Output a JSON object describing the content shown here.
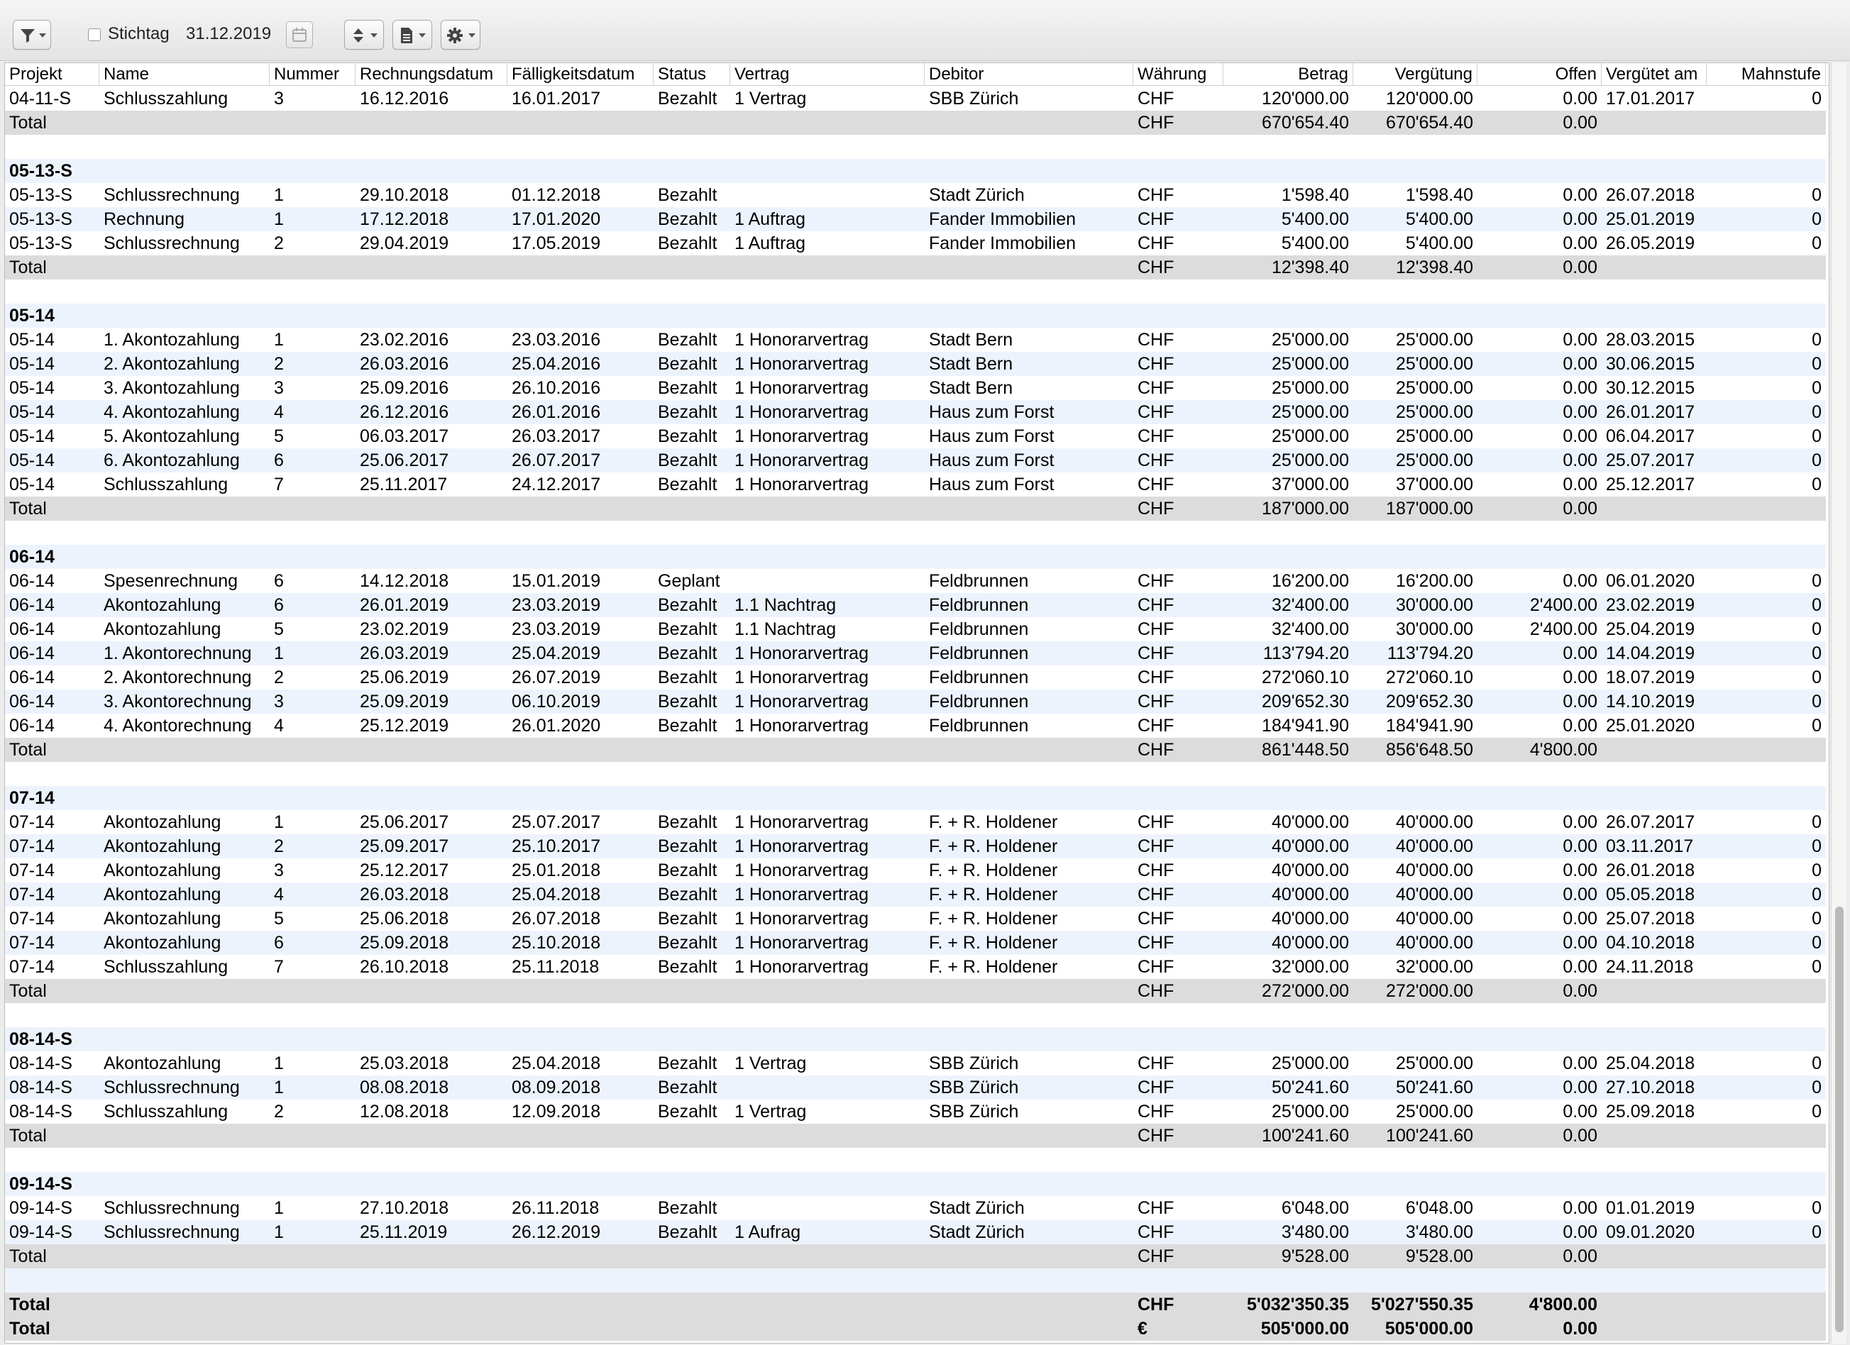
{
  "toolbar": {
    "stichtag_label": "Stichtag",
    "stichtag_checked": false,
    "stichtag_date": "31.12.2019",
    "icons": [
      "filter-icon",
      "sort-icon",
      "document-icon",
      "gear-icon",
      "calendar-icon"
    ]
  },
  "columns": [
    "Projekt",
    "Name",
    "Nummer",
    "Rechnungsdatum",
    "Fälligkeitsdatum",
    "Status",
    "Vertrag",
    "Debitor",
    "Währung",
    "Betrag",
    "Vergütung",
    "Offen",
    "Vergütet am",
    "Mahnstufe"
  ],
  "rows": [
    {
      "type": "data",
      "cells": [
        "04-11-S",
        "Schlusszahlung",
        "3",
        "16.12.2016",
        "16.01.2017",
        "Bezahlt",
        "1 Vertrag",
        "SBB Zürich",
        "CHF",
        "120'000.00",
        "120'000.00",
        "0.00",
        "17.01.2017",
        "0"
      ]
    },
    {
      "type": "total",
      "cells": [
        "Total",
        "",
        "",
        "",
        "",
        "",
        "",
        "",
        "CHF",
        "670'654.40",
        "670'654.40",
        "0.00",
        "",
        ""
      ]
    },
    {
      "type": "blank",
      "cells": [
        "",
        "",
        "",
        "",
        "",
        "",
        "",
        "",
        "",
        "",
        "",
        "",
        "",
        ""
      ]
    },
    {
      "type": "group",
      "cells": [
        "05-13-S",
        "",
        "",
        "",
        "",
        "",
        "",
        "",
        "",
        "",
        "",
        "",
        "",
        ""
      ]
    },
    {
      "type": "data",
      "cells": [
        "05-13-S",
        "Schlussrechnung",
        "1",
        "29.10.2018",
        "01.12.2018",
        "Bezahlt",
        "",
        "Stadt Zürich",
        "CHF",
        "1'598.40",
        "1'598.40",
        "0.00",
        "26.07.2018",
        "0"
      ]
    },
    {
      "type": "data",
      "cells": [
        "05-13-S",
        "Rechnung",
        "1",
        "17.12.2018",
        "17.01.2020",
        "Bezahlt",
        "1 Auftrag",
        "Fander Immobilien",
        "CHF",
        "5'400.00",
        "5'400.00",
        "0.00",
        "25.01.2019",
        "0"
      ]
    },
    {
      "type": "data",
      "cells": [
        "05-13-S",
        "Schlussrechnung",
        "2",
        "29.04.2019",
        "17.05.2019",
        "Bezahlt",
        "1 Auftrag",
        "Fander Immobilien",
        "CHF",
        "5'400.00",
        "5'400.00",
        "0.00",
        "26.05.2019",
        "0"
      ]
    },
    {
      "type": "total",
      "cells": [
        "Total",
        "",
        "",
        "",
        "",
        "",
        "",
        "",
        "CHF",
        "12'398.40",
        "12'398.40",
        "0.00",
        "",
        ""
      ]
    },
    {
      "type": "blank",
      "cells": [
        "",
        "",
        "",
        "",
        "",
        "",
        "",
        "",
        "",
        "",
        "",
        "",
        "",
        ""
      ]
    },
    {
      "type": "group",
      "cells": [
        "05-14",
        "",
        "",
        "",
        "",
        "",
        "",
        "",
        "",
        "",
        "",
        "",
        "",
        ""
      ]
    },
    {
      "type": "data",
      "cells": [
        "05-14",
        "1. Akontozahlung",
        "1",
        "23.02.2016",
        "23.03.2016",
        "Bezahlt",
        "1 Honorarvertrag",
        "Stadt Bern",
        "CHF",
        "25'000.00",
        "25'000.00",
        "0.00",
        "28.03.2015",
        "0"
      ]
    },
    {
      "type": "data",
      "cells": [
        "05-14",
        "2. Akontozahlung",
        "2",
        "26.03.2016",
        "25.04.2016",
        "Bezahlt",
        "1 Honorarvertrag",
        "Stadt Bern",
        "CHF",
        "25'000.00",
        "25'000.00",
        "0.00",
        "30.06.2015",
        "0"
      ]
    },
    {
      "type": "data",
      "cells": [
        "05-14",
        "3. Akontozahlung",
        "3",
        "25.09.2016",
        "26.10.2016",
        "Bezahlt",
        "1 Honorarvertrag",
        "Stadt Bern",
        "CHF",
        "25'000.00",
        "25'000.00",
        "0.00",
        "30.12.2015",
        "0"
      ]
    },
    {
      "type": "data",
      "cells": [
        "05-14",
        "4. Akontozahlung",
        "4",
        "26.12.2016",
        "26.01.2016",
        "Bezahlt",
        "1 Honorarvertrag",
        "Haus zum Forst",
        "CHF",
        "25'000.00",
        "25'000.00",
        "0.00",
        "26.01.2017",
        "0"
      ]
    },
    {
      "type": "data",
      "cells": [
        "05-14",
        "5. Akontozahlung",
        "5",
        "06.03.2017",
        "26.03.2017",
        "Bezahlt",
        "1 Honorarvertrag",
        "Haus zum Forst",
        "CHF",
        "25'000.00",
        "25'000.00",
        "0.00",
        "06.04.2017",
        "0"
      ]
    },
    {
      "type": "data",
      "cells": [
        "05-14",
        "6. Akontozahlung",
        "6",
        "25.06.2017",
        "26.07.2017",
        "Bezahlt",
        "1 Honorarvertrag",
        "Haus zum Forst",
        "CHF",
        "25'000.00",
        "25'000.00",
        "0.00",
        "25.07.2017",
        "0"
      ]
    },
    {
      "type": "data",
      "cells": [
        "05-14",
        "Schlusszahlung",
        "7",
        "25.11.2017",
        "24.12.2017",
        "Bezahlt",
        "1 Honorarvertrag",
        "Haus zum Forst",
        "CHF",
        "37'000.00",
        "37'000.00",
        "0.00",
        "25.12.2017",
        "0"
      ]
    },
    {
      "type": "total",
      "cells": [
        "Total",
        "",
        "",
        "",
        "",
        "",
        "",
        "",
        "CHF",
        "187'000.00",
        "187'000.00",
        "0.00",
        "",
        ""
      ]
    },
    {
      "type": "blank",
      "cells": [
        "",
        "",
        "",
        "",
        "",
        "",
        "",
        "",
        "",
        "",
        "",
        "",
        "",
        ""
      ]
    },
    {
      "type": "group",
      "cells": [
        "06-14",
        "",
        "",
        "",
        "",
        "",
        "",
        "",
        "",
        "",
        "",
        "",
        "",
        ""
      ]
    },
    {
      "type": "data",
      "cells": [
        "06-14",
        "Spesenrechnung",
        "6",
        "14.12.2018",
        "15.01.2019",
        "Geplant",
        "",
        "Feldbrunnen",
        "CHF",
        "16'200.00",
        "16'200.00",
        "0.00",
        "06.01.2020",
        "0"
      ]
    },
    {
      "type": "data",
      "cells": [
        "06-14",
        "Akontozahlung",
        "6",
        "26.01.2019",
        "23.03.2019",
        "Bezahlt",
        "1.1 Nachtrag",
        "Feldbrunnen",
        "CHF",
        "32'400.00",
        "30'000.00",
        "2'400.00",
        "23.02.2019",
        "0"
      ]
    },
    {
      "type": "data",
      "cells": [
        "06-14",
        "Akontozahlung",
        "5",
        "23.02.2019",
        "23.03.2019",
        "Bezahlt",
        "1.1 Nachtrag",
        "Feldbrunnen",
        "CHF",
        "32'400.00",
        "30'000.00",
        "2'400.00",
        "25.04.2019",
        "0"
      ]
    },
    {
      "type": "data",
      "cells": [
        "06-14",
        "1. Akontorechnung",
        "1",
        "26.03.2019",
        "25.04.2019",
        "Bezahlt",
        "1 Honorarvertrag",
        "Feldbrunnen",
        "CHF",
        "113'794.20",
        "113'794.20",
        "0.00",
        "14.04.2019",
        "0"
      ]
    },
    {
      "type": "data",
      "cells": [
        "06-14",
        "2. Akontorechnung",
        "2",
        "25.06.2019",
        "26.07.2019",
        "Bezahlt",
        "1 Honorarvertrag",
        "Feldbrunnen",
        "CHF",
        "272'060.10",
        "272'060.10",
        "0.00",
        "18.07.2019",
        "0"
      ]
    },
    {
      "type": "data",
      "cells": [
        "06-14",
        "3. Akontorechnung",
        "3",
        "25.09.2019",
        "06.10.2019",
        "Bezahlt",
        "1 Honorarvertrag",
        "Feldbrunnen",
        "CHF",
        "209'652.30",
        "209'652.30",
        "0.00",
        "14.10.2019",
        "0"
      ]
    },
    {
      "type": "data",
      "cells": [
        "06-14",
        "4. Akontorechnung",
        "4",
        "25.12.2019",
        "26.01.2020",
        "Bezahlt",
        "1 Honorarvertrag",
        "Feldbrunnen",
        "CHF",
        "184'941.90",
        "184'941.90",
        "0.00",
        "25.01.2020",
        "0"
      ]
    },
    {
      "type": "total",
      "cells": [
        "Total",
        "",
        "",
        "",
        "",
        "",
        "",
        "",
        "CHF",
        "861'448.50",
        "856'648.50",
        "4'800.00",
        "",
        ""
      ]
    },
    {
      "type": "blank",
      "cells": [
        "",
        "",
        "",
        "",
        "",
        "",
        "",
        "",
        "",
        "",
        "",
        "",
        "",
        ""
      ]
    },
    {
      "type": "group",
      "cells": [
        "07-14",
        "",
        "",
        "",
        "",
        "",
        "",
        "",
        "",
        "",
        "",
        "",
        "",
        ""
      ]
    },
    {
      "type": "data",
      "cells": [
        "07-14",
        "Akontozahlung",
        "1",
        "25.06.2017",
        "25.07.2017",
        "Bezahlt",
        "1 Honorarvertrag",
        "F. + R. Holdener",
        "CHF",
        "40'000.00",
        "40'000.00",
        "0.00",
        "26.07.2017",
        "0"
      ]
    },
    {
      "type": "data",
      "cells": [
        "07-14",
        "Akontozahlung",
        "2",
        "25.09.2017",
        "25.10.2017",
        "Bezahlt",
        "1 Honorarvertrag",
        "F. + R. Holdener",
        "CHF",
        "40'000.00",
        "40'000.00",
        "0.00",
        "03.11.2017",
        "0"
      ]
    },
    {
      "type": "data",
      "cells": [
        "07-14",
        "Akontozahlung",
        "3",
        "25.12.2017",
        "25.01.2018",
        "Bezahlt",
        "1 Honorarvertrag",
        "F. + R. Holdener",
        "CHF",
        "40'000.00",
        "40'000.00",
        "0.00",
        "26.01.2018",
        "0"
      ]
    },
    {
      "type": "data",
      "cells": [
        "07-14",
        "Akontozahlung",
        "4",
        "26.03.2018",
        "25.04.2018",
        "Bezahlt",
        "1 Honorarvertrag",
        "F. + R. Holdener",
        "CHF",
        "40'000.00",
        "40'000.00",
        "0.00",
        "05.05.2018",
        "0"
      ]
    },
    {
      "type": "data",
      "cells": [
        "07-14",
        "Akontozahlung",
        "5",
        "25.06.2018",
        "26.07.2018",
        "Bezahlt",
        "1 Honorarvertrag",
        "F. + R. Holdener",
        "CHF",
        "40'000.00",
        "40'000.00",
        "0.00",
        "25.07.2018",
        "0"
      ]
    },
    {
      "type": "data",
      "cells": [
        "07-14",
        "Akontozahlung",
        "6",
        "25.09.2018",
        "25.10.2018",
        "Bezahlt",
        "1 Honorarvertrag",
        "F. + R. Holdener",
        "CHF",
        "40'000.00",
        "40'000.00",
        "0.00",
        "04.10.2018",
        "0"
      ]
    },
    {
      "type": "data",
      "cells": [
        "07-14",
        "Schlusszahlung",
        "7",
        "26.10.2018",
        "25.11.2018",
        "Bezahlt",
        "1 Honorarvertrag",
        "F. + R. Holdener",
        "CHF",
        "32'000.00",
        "32'000.00",
        "0.00",
        "24.11.2018",
        "0"
      ]
    },
    {
      "type": "total",
      "cells": [
        "Total",
        "",
        "",
        "",
        "",
        "",
        "",
        "",
        "CHF",
        "272'000.00",
        "272'000.00",
        "0.00",
        "",
        ""
      ]
    },
    {
      "type": "blank",
      "cells": [
        "",
        "",
        "",
        "",
        "",
        "",
        "",
        "",
        "",
        "",
        "",
        "",
        "",
        ""
      ]
    },
    {
      "type": "group",
      "cells": [
        "08-14-S",
        "",
        "",
        "",
        "",
        "",
        "",
        "",
        "",
        "",
        "",
        "",
        "",
        ""
      ]
    },
    {
      "type": "data",
      "cells": [
        "08-14-S",
        "Akontozahlung",
        "1",
        "25.03.2018",
        "25.04.2018",
        "Bezahlt",
        "1 Vertrag",
        "SBB Zürich",
        "CHF",
        "25'000.00",
        "25'000.00",
        "0.00",
        "25.04.2018",
        "0"
      ]
    },
    {
      "type": "data",
      "cells": [
        "08-14-S",
        "Schlussrechnung",
        "1",
        "08.08.2018",
        "08.09.2018",
        "Bezahlt",
        "",
        "SBB Zürich",
        "CHF",
        "50'241.60",
        "50'241.60",
        "0.00",
        "27.10.2018",
        "0"
      ]
    },
    {
      "type": "data",
      "cells": [
        "08-14-S",
        "Schlusszahlung",
        "2",
        "12.08.2018",
        "12.09.2018",
        "Bezahlt",
        "1 Vertrag",
        "SBB Zürich",
        "CHF",
        "25'000.00",
        "25'000.00",
        "0.00",
        "25.09.2018",
        "0"
      ]
    },
    {
      "type": "total",
      "cells": [
        "Total",
        "",
        "",
        "",
        "",
        "",
        "",
        "",
        "CHF",
        "100'241.60",
        "100'241.60",
        "0.00",
        "",
        ""
      ]
    },
    {
      "type": "blank",
      "cells": [
        "",
        "",
        "",
        "",
        "",
        "",
        "",
        "",
        "",
        "",
        "",
        "",
        "",
        ""
      ]
    },
    {
      "type": "group",
      "cells": [
        "09-14-S",
        "",
        "",
        "",
        "",
        "",
        "",
        "",
        "",
        "",
        "",
        "",
        "",
        ""
      ]
    },
    {
      "type": "data",
      "cells": [
        "09-14-S",
        "Schlussrechnung",
        "1",
        "27.10.2018",
        "26.11.2018",
        "Bezahlt",
        "",
        "Stadt Zürich",
        "CHF",
        "6'048.00",
        "6'048.00",
        "0.00",
        "01.01.2019",
        "0"
      ]
    },
    {
      "type": "data",
      "cells": [
        "09-14-S",
        "Schlussrechnung",
        "1",
        "25.11.2019",
        "26.12.2019",
        "Bezahlt",
        "1 Aufrag",
        "Stadt Zürich",
        "CHF",
        "3'480.00",
        "3'480.00",
        "0.00",
        "09.01.2020",
        "0"
      ]
    },
    {
      "type": "total",
      "cells": [
        "Total",
        "",
        "",
        "",
        "",
        "",
        "",
        "",
        "CHF",
        "9'528.00",
        "9'528.00",
        "0.00",
        "",
        ""
      ]
    },
    {
      "type": "blank",
      "cells": [
        "",
        "",
        "",
        "",
        "",
        "",
        "",
        "",
        "",
        "",
        "",
        "",
        "",
        ""
      ]
    },
    {
      "type": "grandtotal",
      "cells": [
        "Total",
        "",
        "",
        "",
        "",
        "",
        "",
        "",
        "CHF",
        "5'032'350.35",
        "5'027'550.35",
        "4'800.00",
        "",
        ""
      ]
    },
    {
      "type": "grandtotal",
      "cells": [
        "Total",
        "",
        "",
        "",
        "",
        "",
        "",
        "",
        "€",
        "505'000.00",
        "505'000.00",
        "0.00",
        "",
        ""
      ]
    }
  ]
}
